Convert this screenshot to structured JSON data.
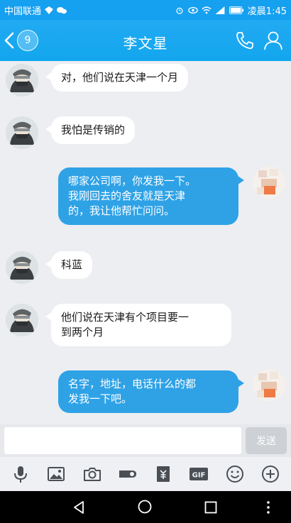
{
  "status_bar": {
    "carrier": "中国联通",
    "time": "凌晨1:45"
  },
  "header": {
    "title": "李文星",
    "unread_count": "9"
  },
  "messages": [
    {
      "from": "contact",
      "text": "对，他们说在天津一个月"
    },
    {
      "from": "contact",
      "text": "我怕是传销的"
    },
    {
      "from": "self",
      "line1": "哪家公司啊，你发我一下。",
      "line2": "我刚回去的舍友就是天津",
      "line3": "的，我让他帮忙问问。"
    },
    {
      "from": "contact",
      "text": "科蓝"
    },
    {
      "from": "contact",
      "line1": "他们说在天津有个项目要一",
      "line2": "到两个月"
    },
    {
      "from": "self",
      "line1": "名字，地址，电话什么的都",
      "line2": "发我一下吧。"
    }
  ],
  "input": {
    "placeholder": "",
    "send_label": "发送"
  },
  "toolbar": [
    "microphone-icon",
    "image-icon",
    "camera-icon",
    "red-packet-icon",
    "payment-icon",
    "gif-icon",
    "emoji-icon",
    "more-icon"
  ],
  "colors": {
    "accent": "#16a0f0",
    "bubble_self": "#2fa2e6",
    "bubble_contact": "#ffffff"
  }
}
